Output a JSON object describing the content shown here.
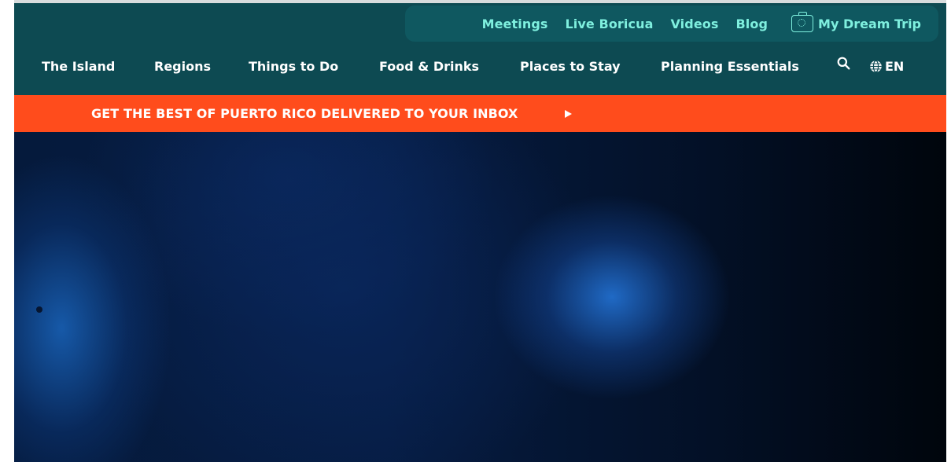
{
  "utility_nav": {
    "links": [
      "Meetings",
      "Live Boricua",
      "Videos",
      "Blog"
    ],
    "dream_trip": {
      "icon": "suitcase-icon",
      "label": "My Dream Trip"
    }
  },
  "main_nav": {
    "items": [
      "The Island",
      "Regions",
      "Things to Do",
      "Food & Drinks",
      "Places to Stay",
      "Planning Essentials"
    ],
    "search_icon": "search-icon",
    "language": {
      "icon": "globe-icon",
      "label": "EN"
    }
  },
  "promo_banner": {
    "text": "GET THE BEST OF PUERTO RICO DELIVERED TO YOUR INBOX",
    "icon": "play-arrow-icon"
  },
  "colors": {
    "header_bg": "#0d4a52",
    "utility_bg": "#0f5860",
    "utility_text": "#7ff0df",
    "promo_bg": "#ff4c1c",
    "hero_blue": "#1a5fb4"
  }
}
